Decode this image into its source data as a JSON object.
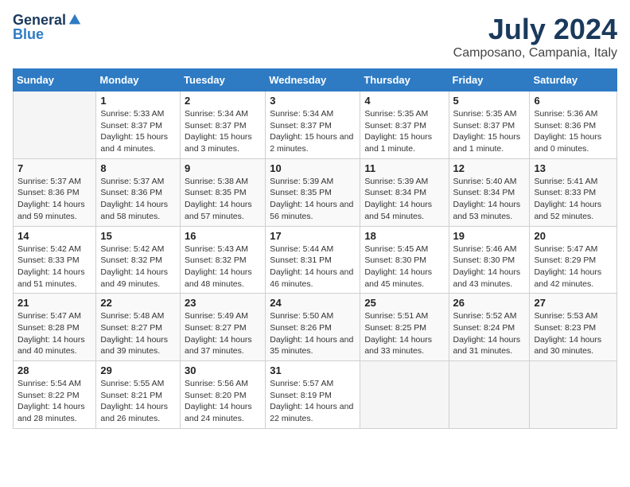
{
  "logo": {
    "general": "General",
    "blue": "Blue"
  },
  "header": {
    "title": "July 2024",
    "subtitle": "Camposano, Campania, Italy"
  },
  "weekdays": [
    "Sunday",
    "Monday",
    "Tuesday",
    "Wednesday",
    "Thursday",
    "Friday",
    "Saturday"
  ],
  "weeks": [
    [
      {
        "day": "",
        "sunrise": "",
        "sunset": "",
        "daylight": ""
      },
      {
        "day": "1",
        "sunrise": "Sunrise: 5:33 AM",
        "sunset": "Sunset: 8:37 PM",
        "daylight": "Daylight: 15 hours and 4 minutes."
      },
      {
        "day": "2",
        "sunrise": "Sunrise: 5:34 AM",
        "sunset": "Sunset: 8:37 PM",
        "daylight": "Daylight: 15 hours and 3 minutes."
      },
      {
        "day": "3",
        "sunrise": "Sunrise: 5:34 AM",
        "sunset": "Sunset: 8:37 PM",
        "daylight": "Daylight: 15 hours and 2 minutes."
      },
      {
        "day": "4",
        "sunrise": "Sunrise: 5:35 AM",
        "sunset": "Sunset: 8:37 PM",
        "daylight": "Daylight: 15 hours and 1 minute."
      },
      {
        "day": "5",
        "sunrise": "Sunrise: 5:35 AM",
        "sunset": "Sunset: 8:37 PM",
        "daylight": "Daylight: 15 hours and 1 minute."
      },
      {
        "day": "6",
        "sunrise": "Sunrise: 5:36 AM",
        "sunset": "Sunset: 8:36 PM",
        "daylight": "Daylight: 15 hours and 0 minutes."
      }
    ],
    [
      {
        "day": "7",
        "sunrise": "Sunrise: 5:37 AM",
        "sunset": "Sunset: 8:36 PM",
        "daylight": "Daylight: 14 hours and 59 minutes."
      },
      {
        "day": "8",
        "sunrise": "Sunrise: 5:37 AM",
        "sunset": "Sunset: 8:36 PM",
        "daylight": "Daylight: 14 hours and 58 minutes."
      },
      {
        "day": "9",
        "sunrise": "Sunrise: 5:38 AM",
        "sunset": "Sunset: 8:35 PM",
        "daylight": "Daylight: 14 hours and 57 minutes."
      },
      {
        "day": "10",
        "sunrise": "Sunrise: 5:39 AM",
        "sunset": "Sunset: 8:35 PM",
        "daylight": "Daylight: 14 hours and 56 minutes."
      },
      {
        "day": "11",
        "sunrise": "Sunrise: 5:39 AM",
        "sunset": "Sunset: 8:34 PM",
        "daylight": "Daylight: 14 hours and 54 minutes."
      },
      {
        "day": "12",
        "sunrise": "Sunrise: 5:40 AM",
        "sunset": "Sunset: 8:34 PM",
        "daylight": "Daylight: 14 hours and 53 minutes."
      },
      {
        "day": "13",
        "sunrise": "Sunrise: 5:41 AM",
        "sunset": "Sunset: 8:33 PM",
        "daylight": "Daylight: 14 hours and 52 minutes."
      }
    ],
    [
      {
        "day": "14",
        "sunrise": "Sunrise: 5:42 AM",
        "sunset": "Sunset: 8:33 PM",
        "daylight": "Daylight: 14 hours and 51 minutes."
      },
      {
        "day": "15",
        "sunrise": "Sunrise: 5:42 AM",
        "sunset": "Sunset: 8:32 PM",
        "daylight": "Daylight: 14 hours and 49 minutes."
      },
      {
        "day": "16",
        "sunrise": "Sunrise: 5:43 AM",
        "sunset": "Sunset: 8:32 PM",
        "daylight": "Daylight: 14 hours and 48 minutes."
      },
      {
        "day": "17",
        "sunrise": "Sunrise: 5:44 AM",
        "sunset": "Sunset: 8:31 PM",
        "daylight": "Daylight: 14 hours and 46 minutes."
      },
      {
        "day": "18",
        "sunrise": "Sunrise: 5:45 AM",
        "sunset": "Sunset: 8:30 PM",
        "daylight": "Daylight: 14 hours and 45 minutes."
      },
      {
        "day": "19",
        "sunrise": "Sunrise: 5:46 AM",
        "sunset": "Sunset: 8:30 PM",
        "daylight": "Daylight: 14 hours and 43 minutes."
      },
      {
        "day": "20",
        "sunrise": "Sunrise: 5:47 AM",
        "sunset": "Sunset: 8:29 PM",
        "daylight": "Daylight: 14 hours and 42 minutes."
      }
    ],
    [
      {
        "day": "21",
        "sunrise": "Sunrise: 5:47 AM",
        "sunset": "Sunset: 8:28 PM",
        "daylight": "Daylight: 14 hours and 40 minutes."
      },
      {
        "day": "22",
        "sunrise": "Sunrise: 5:48 AM",
        "sunset": "Sunset: 8:27 PM",
        "daylight": "Daylight: 14 hours and 39 minutes."
      },
      {
        "day": "23",
        "sunrise": "Sunrise: 5:49 AM",
        "sunset": "Sunset: 8:27 PM",
        "daylight": "Daylight: 14 hours and 37 minutes."
      },
      {
        "day": "24",
        "sunrise": "Sunrise: 5:50 AM",
        "sunset": "Sunset: 8:26 PM",
        "daylight": "Daylight: 14 hours and 35 minutes."
      },
      {
        "day": "25",
        "sunrise": "Sunrise: 5:51 AM",
        "sunset": "Sunset: 8:25 PM",
        "daylight": "Daylight: 14 hours and 33 minutes."
      },
      {
        "day": "26",
        "sunrise": "Sunrise: 5:52 AM",
        "sunset": "Sunset: 8:24 PM",
        "daylight": "Daylight: 14 hours and 31 minutes."
      },
      {
        "day": "27",
        "sunrise": "Sunrise: 5:53 AM",
        "sunset": "Sunset: 8:23 PM",
        "daylight": "Daylight: 14 hours and 30 minutes."
      }
    ],
    [
      {
        "day": "28",
        "sunrise": "Sunrise: 5:54 AM",
        "sunset": "Sunset: 8:22 PM",
        "daylight": "Daylight: 14 hours and 28 minutes."
      },
      {
        "day": "29",
        "sunrise": "Sunrise: 5:55 AM",
        "sunset": "Sunset: 8:21 PM",
        "daylight": "Daylight: 14 hours and 26 minutes."
      },
      {
        "day": "30",
        "sunrise": "Sunrise: 5:56 AM",
        "sunset": "Sunset: 8:20 PM",
        "daylight": "Daylight: 14 hours and 24 minutes."
      },
      {
        "day": "31",
        "sunrise": "Sunrise: 5:57 AM",
        "sunset": "Sunset: 8:19 PM",
        "daylight": "Daylight: 14 hours and 22 minutes."
      },
      {
        "day": "",
        "sunrise": "",
        "sunset": "",
        "daylight": ""
      },
      {
        "day": "",
        "sunrise": "",
        "sunset": "",
        "daylight": ""
      },
      {
        "day": "",
        "sunrise": "",
        "sunset": "",
        "daylight": ""
      }
    ]
  ]
}
